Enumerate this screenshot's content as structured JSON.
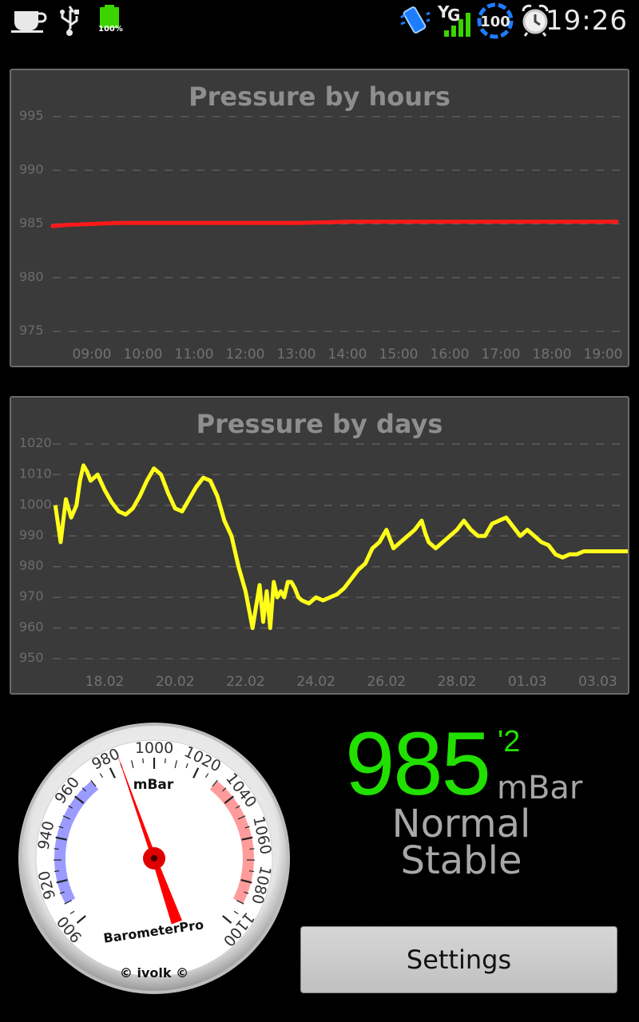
{
  "status_bar": {
    "time": "19:26",
    "battery_label": "100%",
    "signal_network": "G",
    "badge_count": "100",
    "icons": [
      "coffee-cup-icon",
      "usb-icon",
      "battery-icon",
      "vibrate-icon",
      "signal-icon",
      "sync-badge-icon",
      "alarm-clock-icon"
    ]
  },
  "charts": {
    "hours": {
      "title": "Pressure by hours",
      "series_color": "#ff1a1a",
      "y_ticks": [
        "995",
        "990",
        "985",
        "980",
        "975"
      ],
      "x_ticks": [
        "09:00",
        "10:00",
        "11:00",
        "12:00",
        "13:00",
        "14:00",
        "15:00",
        "16:00",
        "17:00",
        "18:00",
        "19:00"
      ]
    },
    "days": {
      "title": "Pressure by days",
      "series_color": "#ffff1a",
      "y_ticks": [
        "1020",
        "1010",
        "1000",
        "990",
        "980",
        "970",
        "960",
        "950"
      ],
      "x_ticks": [
        "18.02",
        "20.02",
        "22.02",
        "24.02",
        "26.02",
        "28.02",
        "01.03",
        "03.03"
      ]
    }
  },
  "chart_data": [
    {
      "type": "line",
      "title": "Pressure by hours",
      "ylim": [
        975,
        995
      ],
      "y_ticks": [
        995,
        990,
        985,
        980,
        975
      ],
      "x_ticks": [
        "09:00",
        "10:00",
        "11:00",
        "12:00",
        "13:00",
        "14:00",
        "15:00",
        "16:00",
        "17:00",
        "18:00",
        "19:00"
      ],
      "x": [
        8.2,
        8.5,
        9.0,
        9.5,
        10.0,
        11.0,
        12.0,
        13.0,
        14.0,
        15.0,
        16.0,
        17.0,
        18.0,
        19.0,
        19.3
      ],
      "values": [
        984.8,
        984.9,
        985.0,
        985.1,
        985.1,
        985.1,
        985.1,
        985.1,
        985.2,
        985.2,
        985.2,
        985.2,
        985.2,
        985.2,
        985.2
      ]
    },
    {
      "type": "line",
      "title": "Pressure by days",
      "ylim": [
        950,
        1020
      ],
      "y_ticks": [
        1020,
        1010,
        1000,
        990,
        980,
        970,
        960,
        950
      ],
      "x_ticks": [
        "18.02",
        "20.02",
        "22.02",
        "24.02",
        "26.02",
        "28.02",
        "01.03",
        "03.03"
      ],
      "x": [
        16.6,
        16.75,
        16.9,
        17.05,
        17.2,
        17.3,
        17.4,
        17.5,
        17.6,
        17.8,
        18.0,
        18.2,
        18.4,
        18.6,
        18.8,
        19.0,
        19.2,
        19.4,
        19.6,
        19.8,
        20.0,
        20.2,
        20.4,
        20.6,
        20.8,
        21.0,
        21.2,
        21.4,
        21.6,
        21.8,
        22.0,
        22.2,
        22.4,
        22.5,
        22.6,
        22.7,
        22.8,
        22.9,
        23.0,
        23.1,
        23.2,
        23.3,
        23.4,
        23.5,
        23.6,
        23.8,
        24.0,
        24.2,
        24.4,
        24.6,
        24.8,
        25.0,
        25.2,
        25.4,
        25.6,
        25.8,
        26.0,
        26.2,
        26.4,
        26.6,
        26.8,
        27.0,
        27.1,
        27.2,
        27.4,
        27.6,
        27.8,
        28.0,
        28.2,
        28.4,
        28.6,
        28.8,
        29.0,
        29.2,
        29.4,
        29.6,
        29.8,
        30.0,
        30.2,
        30.4,
        30.6,
        30.8,
        31.0,
        31.2,
        31.4,
        31.6,
        31.8,
        32.0,
        32.2,
        32.4,
        32.6,
        32.8,
        33.0,
        33.2,
        33.4,
        33.6
      ],
      "values": [
        1000,
        988,
        1002,
        996,
        1000,
        1008,
        1013,
        1011,
        1008,
        1010,
        1005,
        1001,
        998,
        997,
        999,
        1003,
        1008,
        1012,
        1010,
        1004,
        999,
        998,
        1002,
        1006,
        1009,
        1008,
        1003,
        995,
        990,
        980,
        972,
        960,
        974,
        962,
        972,
        960,
        975,
        970,
        972,
        970,
        975,
        975,
        973,
        970,
        969,
        968,
        970,
        969,
        970,
        971,
        973,
        976,
        979,
        981,
        986,
        988,
        992,
        986,
        988,
        990,
        992,
        995,
        991,
        988,
        986,
        988,
        990,
        992,
        995,
        992,
        990,
        990,
        994,
        995,
        996,
        993,
        990,
        992,
        990,
        988,
        987,
        984,
        983,
        984,
        984,
        985,
        985,
        985,
        985,
        985,
        985,
        985,
        985,
        985,
        985,
        985
      ]
    }
  ],
  "gauge": {
    "unit_label": "mBar",
    "brand_label": "BarometerPro",
    "credit_label": "© ivolk ©",
    "scale_labels": [
      "900",
      "920",
      "940",
      "960",
      "980",
      "1000",
      "1020",
      "1040",
      "1060",
      "1080",
      "1100"
    ],
    "needle_value": 985,
    "needle_color": "#ff0000",
    "low_band_color": "#8a8aff",
    "high_band_color": "#ff8a8a"
  },
  "reading": {
    "value": "985",
    "decimal": "'2",
    "unit": "mBar",
    "level": "Normal",
    "trend": "Stable",
    "value_color": "#21e000"
  },
  "settings": {
    "label": "Settings"
  }
}
